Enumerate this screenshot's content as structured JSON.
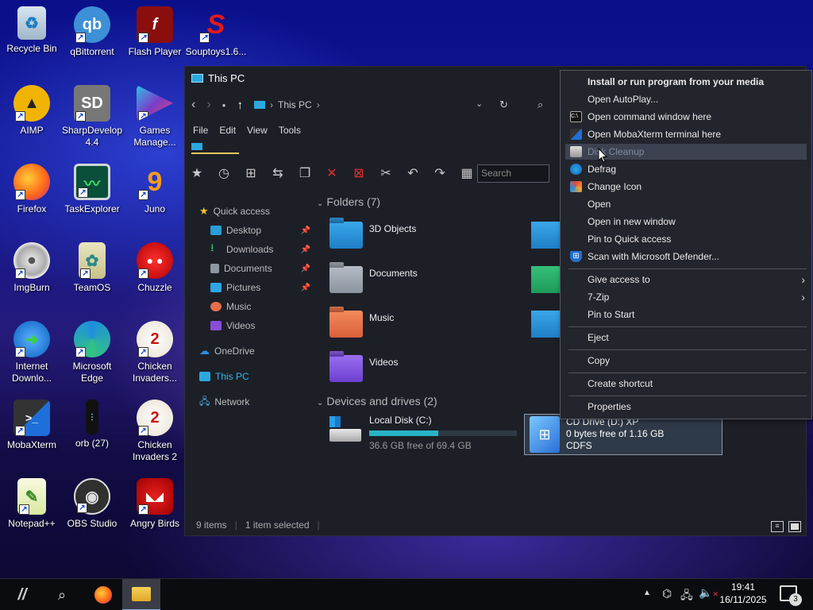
{
  "desktop_icons": [
    {
      "label": "Recycle Bin",
      "icon": "recycle-bin-icon"
    },
    {
      "label": "qBittorrent",
      "icon": "qbittorrent-icon"
    },
    {
      "label": "Flash Player",
      "icon": "flash-icon"
    },
    {
      "label": "Souptoys1.6...",
      "icon": "souptoys-icon"
    },
    {
      "label": "AIMP",
      "icon": "aimp-icon"
    },
    {
      "label": "SharpDevelop 4.4",
      "icon": "sharpdevelop-icon"
    },
    {
      "label": "Games Manage...",
      "icon": "games-icon"
    },
    {
      "label": "Firefox",
      "icon": "firefox-icon"
    },
    {
      "label": "TaskExplorer",
      "icon": "taskexplorer-icon"
    },
    {
      "label": "Juno",
      "icon": "juno-icon"
    },
    {
      "label": "ImgBurn",
      "icon": "imgburn-icon"
    },
    {
      "label": "TeamOS",
      "icon": "teamos-icon"
    },
    {
      "label": "Chuzzle",
      "icon": "chuzzle-icon"
    },
    {
      "label": "Internet Downlo...",
      "icon": "idm-icon"
    },
    {
      "label": "Microsoft Edge",
      "icon": "edge-icon"
    },
    {
      "label": "Chicken Invaders...",
      "icon": "chicken-icon"
    },
    {
      "label": "MobaXterm",
      "icon": "mobaxterm-icon"
    },
    {
      "label": "orb (27)",
      "icon": "orb-icon"
    },
    {
      "label": "Chicken Invaders 2",
      "icon": "chicken2-icon"
    },
    {
      "label": "Notepad++",
      "icon": "notepadpp-icon"
    },
    {
      "label": "OBS Studio",
      "icon": "obs-icon"
    },
    {
      "label": "Angry Birds",
      "icon": "angrybirds-icon"
    }
  ],
  "explorer": {
    "title": "This PC",
    "breadcrumb": "This PC",
    "menu": [
      "File",
      "Edit",
      "View",
      "Tools"
    ],
    "ribbon_tab": "This PC",
    "search_placeholder": "Search",
    "sidebar": {
      "quick_access": "Quick access",
      "items": [
        "Desktop",
        "Downloads",
        "Documents",
        "Pictures",
        "Music",
        "Videos"
      ],
      "onedrive": "OneDrive",
      "thispc": "This PC",
      "network": "Network"
    },
    "folders_header": "Folders (7)",
    "folders": [
      "3D Objects",
      "Documents",
      "Music",
      "Videos"
    ],
    "devices_header": "Devices and drives (2)",
    "local_disk": {
      "name": "Local Disk (C:)",
      "free": "36.6 GB free of 69.4 GB",
      "used_fraction": 0.47
    },
    "cd_drive": {
      "name": "CD Drive (D:) XP",
      "free": "0 bytes free of 1.16 GB",
      "fs": "CDFS"
    },
    "status": {
      "items": "9 items",
      "selected": "1 item selected"
    }
  },
  "context_menu": {
    "header": "Install or run program from your media",
    "items": [
      "Open AutoPlay...",
      "Open command window here",
      "Open MobaXterm terminal here",
      "Disk Cleanup",
      "Defrag",
      "Change Icon",
      "Open",
      "Open in new window",
      "Pin to Quick access",
      "Scan with Microsoft Defender...",
      "Give access to",
      "7-Zip",
      "Pin to Start",
      "Eject",
      "Copy",
      "Create shortcut",
      "Properties"
    ]
  },
  "taskbar": {
    "time": "19:41",
    "date": "16/11/2025",
    "notifications": "3"
  }
}
